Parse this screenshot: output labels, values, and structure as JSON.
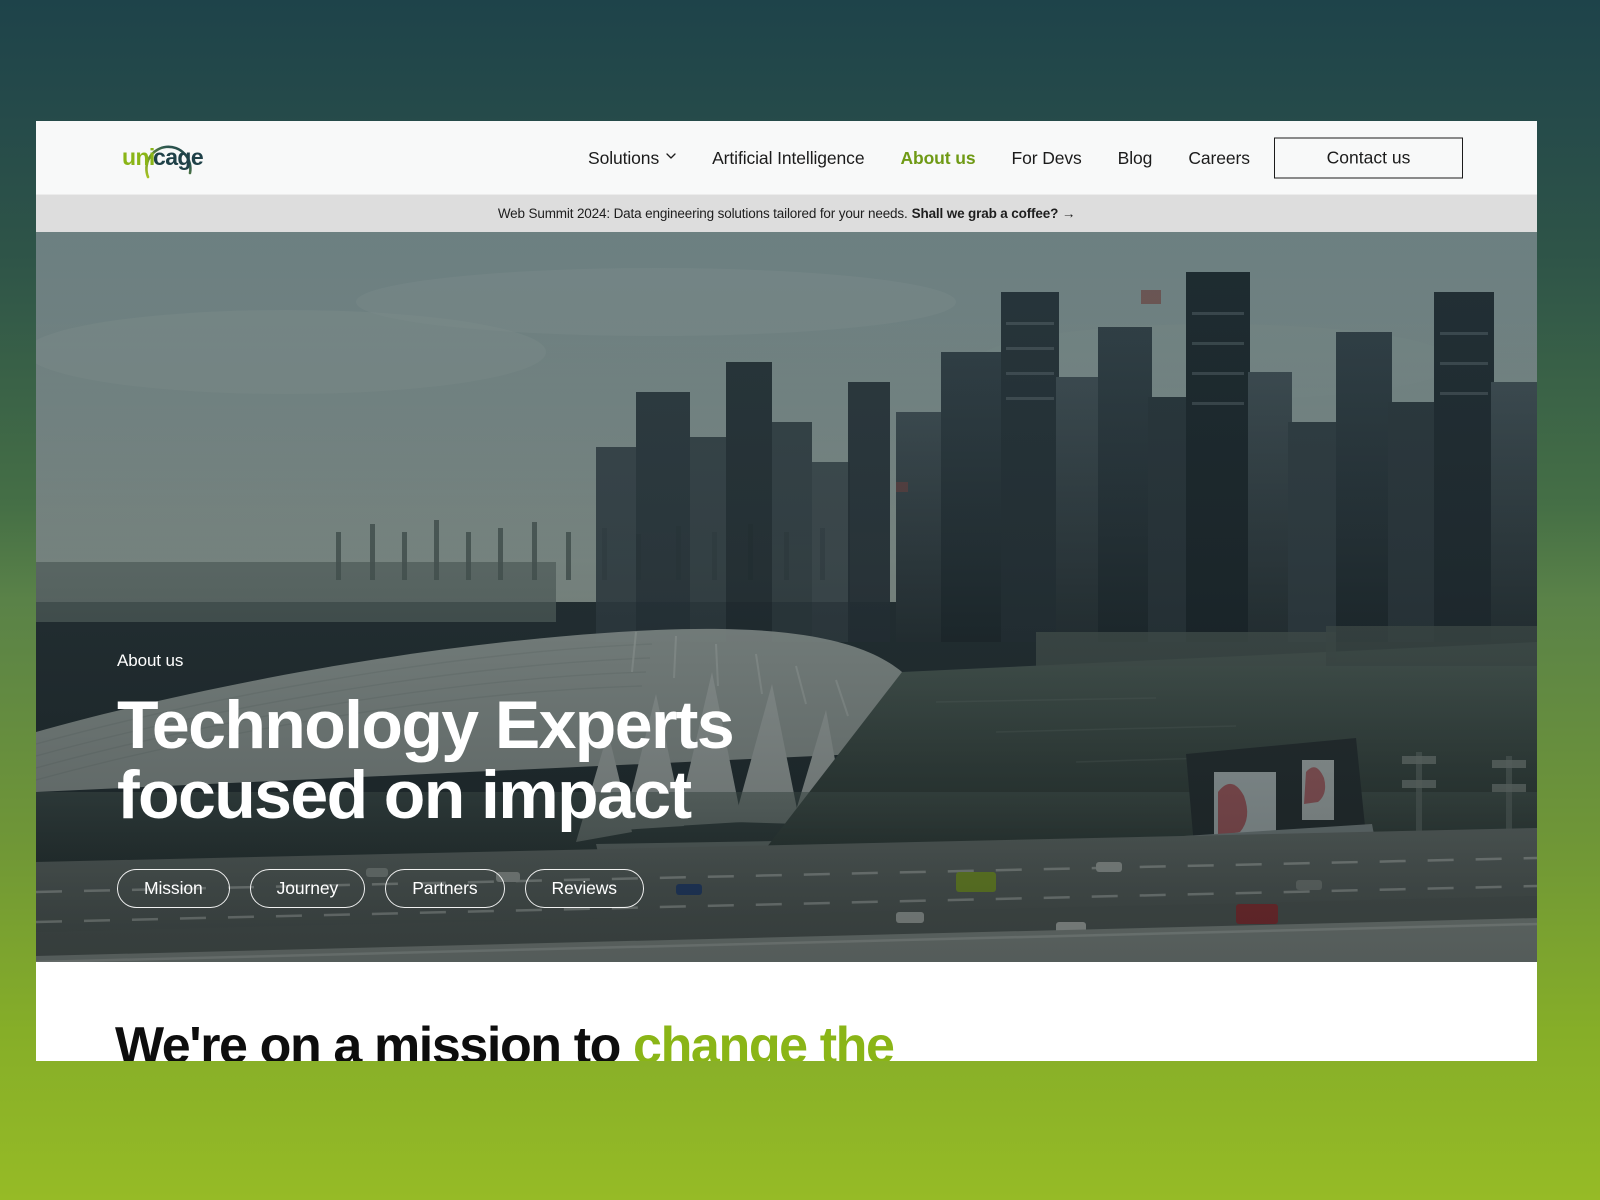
{
  "brand": {
    "logo_text_1": "uni",
    "logo_text_2": "cage",
    "logo_green": "#8ab517",
    "logo_dark": "#1f4148"
  },
  "header": {
    "nav_items": [
      {
        "label": "Solutions",
        "icon": "chevron-down-icon",
        "has_chevron": true,
        "active": false
      },
      {
        "label": "Artificial Intelligence",
        "has_chevron": false,
        "active": false
      },
      {
        "label": "About us",
        "has_chevron": false,
        "active": true
      },
      {
        "label": "For Devs",
        "has_chevron": false,
        "active": false
      },
      {
        "label": "Blog",
        "has_chevron": false,
        "active": false
      },
      {
        "label": "Careers",
        "has_chevron": false,
        "active": false
      }
    ],
    "contact_label": "Contact us"
  },
  "announcement": {
    "text": "Web Summit 2024: Data engineering solutions tailored for your needs.",
    "cta": "Shall we grab a coffee? →"
  },
  "hero": {
    "eyebrow": "About us",
    "title_line_1": "Technology Experts",
    "title_line_2": "focused on impact",
    "pills": [
      {
        "label": "Mission"
      },
      {
        "label": "Journey"
      },
      {
        "label": "Partners"
      },
      {
        "label": "Reviews"
      }
    ],
    "image_alt": "Aerial photo of Marina Bay Singapore skyline with bridge and water"
  },
  "mission": {
    "heading_part_1": "We're on a mission to ",
    "heading_accent": "change the",
    "accent_color": "#8ab517"
  },
  "theme": {
    "backdrop_top": "#1e434a",
    "backdrop_bottom": "#96bb26",
    "accent_green": "#8ab517",
    "announce_bg": "#dddddd"
  }
}
